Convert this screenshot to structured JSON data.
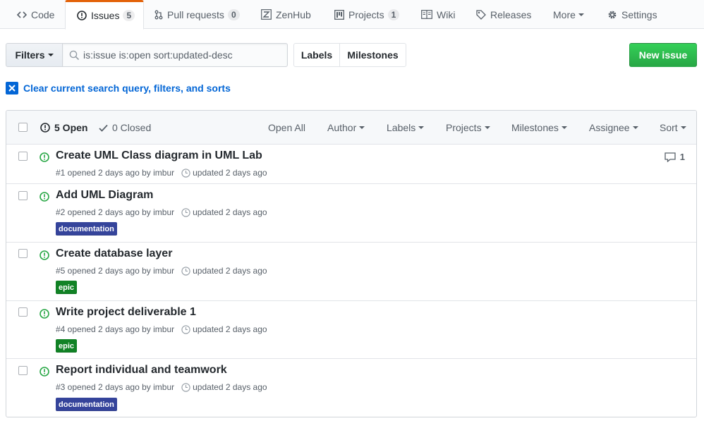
{
  "nav": {
    "tabs": [
      {
        "label": "Code",
        "icon": "code-icon",
        "count": null,
        "selected": false
      },
      {
        "label": "Issues",
        "icon": "issue-opened-icon",
        "count": "5",
        "selected": true
      },
      {
        "label": "Pull requests",
        "icon": "git-pull-request-icon",
        "count": "0",
        "selected": false
      },
      {
        "label": "ZenHub",
        "icon": "zenhub-icon",
        "count": null,
        "selected": false
      },
      {
        "label": "Projects",
        "icon": "project-icon",
        "count": "1",
        "selected": false
      },
      {
        "label": "Wiki",
        "icon": "book-icon",
        "count": null,
        "selected": false
      },
      {
        "label": "Releases",
        "icon": "tag-icon",
        "count": null,
        "selected": false
      },
      {
        "label": "More",
        "icon": "caret-down-icon",
        "count": null,
        "selected": false
      },
      {
        "label": "Settings",
        "icon": "gear-icon",
        "count": null,
        "selected": false
      }
    ]
  },
  "subnav": {
    "filters_label": "Filters",
    "search_value": "is:issue is:open sort:updated-desc",
    "labels_label": "Labels",
    "milestones_label": "Milestones",
    "new_issue_label": "New issue"
  },
  "clear_query": "Clear current search query, filters, and sorts",
  "list_header": {
    "open_label": "5 Open",
    "closed_label": "0 Closed",
    "open_all": "Open All",
    "filters": [
      "Author",
      "Labels",
      "Projects",
      "Milestones",
      "Assignee",
      "Sort"
    ]
  },
  "issues": [
    {
      "title": "Create UML Class diagram in UML Lab",
      "meta": "#1 opened 2 days ago by imbur",
      "updated": "updated 2 days ago",
      "comments": "1",
      "label": null
    },
    {
      "title": "Add UML Diagram",
      "meta": "#2 opened 2 days ago by imbur",
      "updated": "updated 2 days ago",
      "comments": null,
      "label": {
        "text": "documentation",
        "color": "#35449b"
      }
    },
    {
      "title": "Create database layer",
      "meta": "#5 opened 2 days ago by imbur",
      "updated": "updated 2 days ago",
      "comments": null,
      "label": {
        "text": "epic",
        "color": "#118225"
      }
    },
    {
      "title": "Write project deliverable 1",
      "meta": "#4 opened 2 days ago by imbur",
      "updated": "updated 2 days ago",
      "comments": null,
      "label": {
        "text": "epic",
        "color": "#118225"
      }
    },
    {
      "title": "Report individual and teamwork",
      "meta": "#3 opened 2 days ago by imbur",
      "updated": "updated 2 days ago",
      "comments": null,
      "label": {
        "text": "documentation",
        "color": "#35449b"
      }
    }
  ],
  "colors": {
    "accent": "#0366d6",
    "open_green": "#28a745",
    "selected_tab_top": "#e36209",
    "documentation": "#35449b",
    "epic": "#118225"
  }
}
